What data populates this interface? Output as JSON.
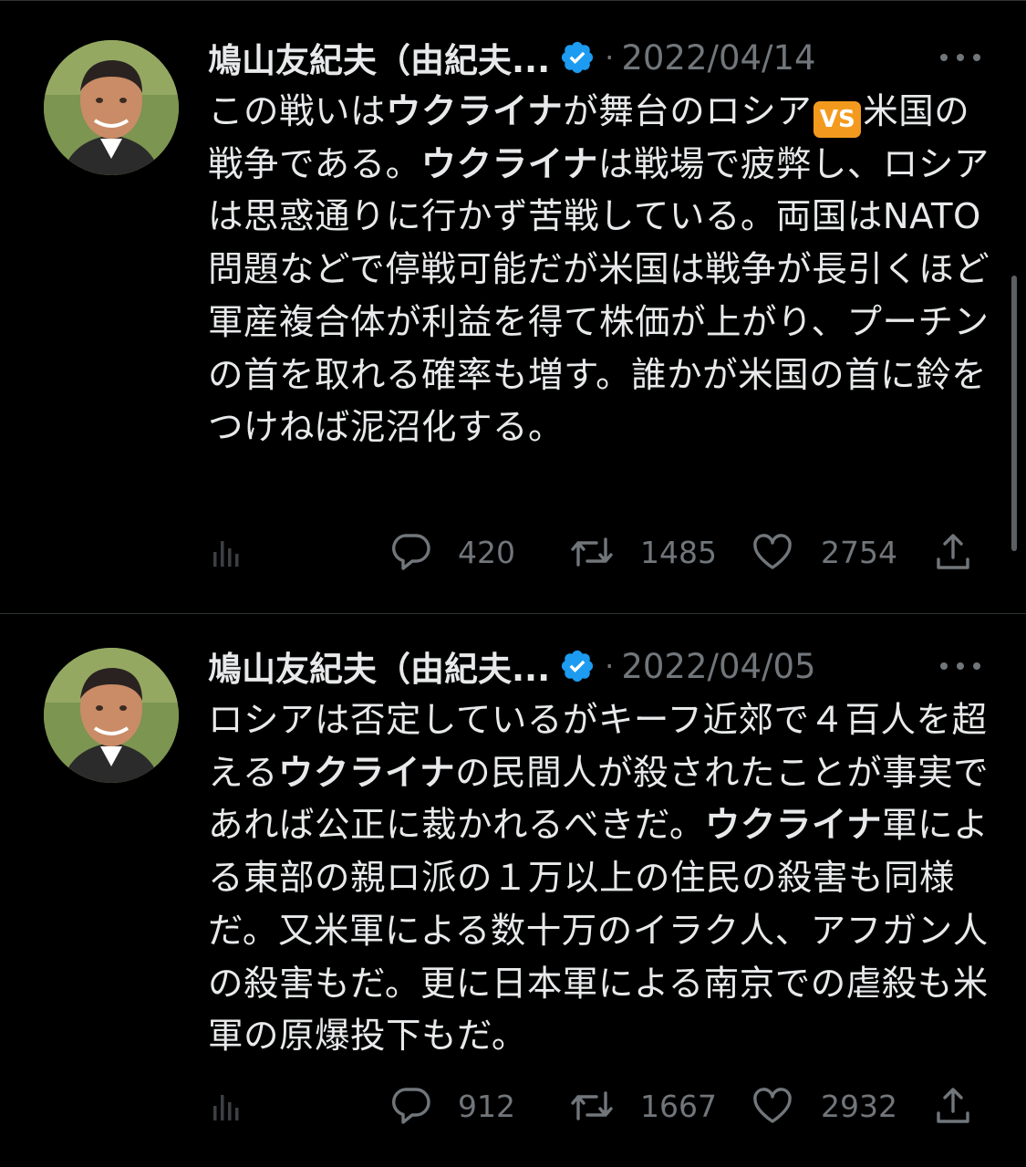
{
  "tweets": [
    {
      "author": "鳩山友紀夫（由紀夫...",
      "date": "2022/04/14",
      "segments": [
        {
          "t": "この戦いは"
        },
        {
          "t": "ウクライナ",
          "b": true
        },
        {
          "t": "が舞台のロシア"
        },
        {
          "t": "VS",
          "vs": true
        },
        {
          "t": "米国の戦争である。"
        },
        {
          "t": "ウクライナ",
          "b": true
        },
        {
          "t": "は戦場で疲弊し、ロシアは思惑通りに行かず苦戦している。両国はNATO問題などで停戦可能だが米国は戦争が長引くほど軍産複合体が利益を得て株価が上がり、プーチンの首を取れる確率も増す。誰かが米国の首に鈴をつけねば泥沼化する。"
        }
      ],
      "stats": {
        "replies": "420",
        "retweets": "1485",
        "likes": "2754"
      }
    },
    {
      "author": "鳩山友紀夫（由紀夫...",
      "date": "2022/04/05",
      "segments": [
        {
          "t": "ロシアは否定しているがキーフ近郊で４百人を超える"
        },
        {
          "t": "ウクライナ",
          "b": true
        },
        {
          "t": "の民間人が殺されたことが事実であれば公正に裁かれるべきだ。"
        },
        {
          "t": "ウクライナ",
          "b": true
        },
        {
          "t": "軍による東部の親ロ派の１万以上の住民の殺害も同様だ。又米軍による数十万のイラク人、アフガン人の殺害もだ。更に日本軍による南京での虐殺も米軍の原爆投下もだ。"
        }
      ],
      "stats": {
        "replies": "912",
        "retweets": "1667",
        "likes": "2932"
      }
    }
  ],
  "colors": {
    "background": "#000000",
    "text": "#e7e9ea",
    "muted": "#71767b",
    "verified": "#1d9bf0",
    "separator": "#2f3336",
    "vs_badge": "#f39a1e"
  },
  "icons": [
    "verified-badge-icon",
    "more-icon",
    "analytics-icon",
    "reply-icon",
    "retweet-icon",
    "like-icon",
    "share-icon"
  ]
}
